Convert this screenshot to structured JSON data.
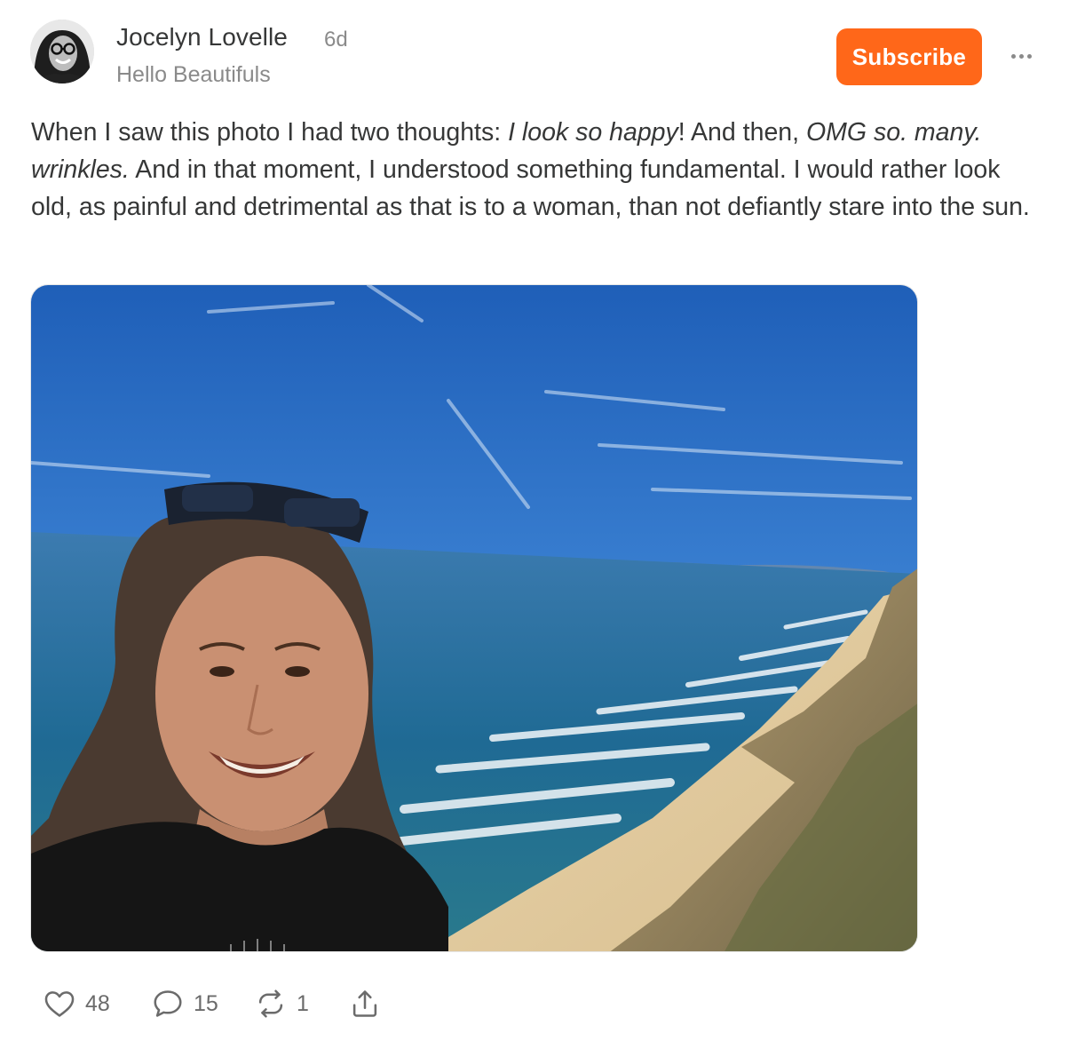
{
  "post": {
    "author_name": "Jocelyn Lovelle",
    "age": "6d",
    "publication": "Hello Beautifuls",
    "subscribe_label": "Subscribe",
    "body": {
      "t1": "When I saw this photo I had two thoughts: ",
      "em1": "I look so happy",
      "t2": "! And then, ",
      "em2": "OMG so. many. wrinkles.",
      "t3": " And in that moment, I understood something fundamental. I would rather look old, as painful and detrimental as that is to a woman, than not defiantly stare into the sun."
    }
  },
  "actions": {
    "likes": "48",
    "comments": "15",
    "restacks": "1"
  },
  "icons": {
    "like": "heart-icon",
    "comment": "speech-bubble-icon",
    "restack": "restack-arrows-icon",
    "share": "share-upload-icon",
    "more": "ellipsis-icon"
  },
  "colors": {
    "accent": "#ff6719",
    "text": "#363737",
    "muted": "#8a8a8a"
  }
}
